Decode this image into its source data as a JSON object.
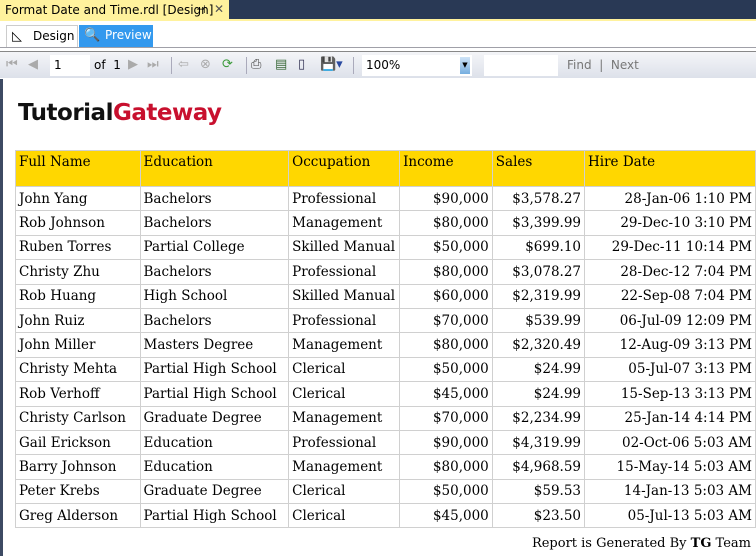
{
  "window": {
    "doc_tab": "Format Date and Time.rdl [Design]",
    "pin_icon": "pin-icon",
    "close_icon": "close-icon"
  },
  "tabs": [
    {
      "label": "Design",
      "icon": "design-icon"
    },
    {
      "label": "Preview",
      "icon": "preview-icon"
    }
  ],
  "toolbar": {
    "page": "1",
    "of_label": "of",
    "total_pages": "1",
    "zoom": "100%",
    "find_label": "Find",
    "next_label": "Next"
  },
  "report": {
    "logo": {
      "part1": "Tutorial",
      "part2": "Gateway"
    },
    "headers": [
      "Full Name",
      "Education",
      "Occupation",
      "Income",
      "Sales",
      "Hire Date"
    ],
    "rows": [
      [
        "John Yang",
        "Bachelors",
        "Professional",
        "$90,000",
        "$3,578.27",
        "28-Jan-06 1:10 PM"
      ],
      [
        "Rob Johnson",
        "Bachelors",
        "Management",
        "$80,000",
        "$3,399.99",
        "29-Dec-10 3:10 PM"
      ],
      [
        "Ruben Torres",
        "Partial College",
        "Skilled Manual",
        "$50,000",
        "$699.10",
        "29-Dec-11 10:14 PM"
      ],
      [
        "Christy Zhu",
        "Bachelors",
        "Professional",
        "$80,000",
        "$3,078.27",
        "28-Dec-12 7:04 PM"
      ],
      [
        "Rob Huang",
        "High School",
        "Skilled Manual",
        "$60,000",
        "$2,319.99",
        "22-Sep-08 7:04 PM"
      ],
      [
        "John Ruiz",
        "Bachelors",
        "Professional",
        "$70,000",
        "$539.99",
        "06-Jul-09 12:09 PM"
      ],
      [
        "John Miller",
        "Masters Degree",
        "Management",
        "$80,000",
        "$2,320.49",
        "12-Aug-09 3:13 PM"
      ],
      [
        "Christy Mehta",
        "Partial High School",
        "Clerical",
        "$50,000",
        "$24.99",
        "05-Jul-07 3:13 PM"
      ],
      [
        "Rob Verhoff",
        "Partial High School",
        "Clerical",
        "$45,000",
        "$24.99",
        "15-Sep-13 3:13 PM"
      ],
      [
        "Christy Carlson",
        "Graduate Degree",
        "Management",
        "$70,000",
        "$2,234.99",
        "25-Jan-14 4:14 PM"
      ],
      [
        "Gail Erickson",
        "Education",
        "Professional",
        "$90,000",
        "$4,319.99",
        "02-Oct-06 5:03 AM"
      ],
      [
        "Barry Johnson",
        "Education",
        "Management",
        "$80,000",
        "$4,968.59",
        "15-May-14 5:03 AM"
      ],
      [
        "Peter Krebs",
        "Graduate Degree",
        "Clerical",
        "$50,000",
        "$59.53",
        "14-Jan-13 5:03 AM"
      ],
      [
        "Greg Alderson",
        "Partial High School",
        "Clerical",
        "$45,000",
        "$23.50",
        "05-Jul-13 5:03 AM"
      ]
    ],
    "footer": {
      "prefix": "Report is Generated By ",
      "bold": "TG",
      "suffix": " Team"
    }
  },
  "colors": {
    "header_bg": "#ffd700",
    "preview_tab": "#3399ee",
    "doc_tab": "#fff29d",
    "logo_red": "#c8102e"
  }
}
